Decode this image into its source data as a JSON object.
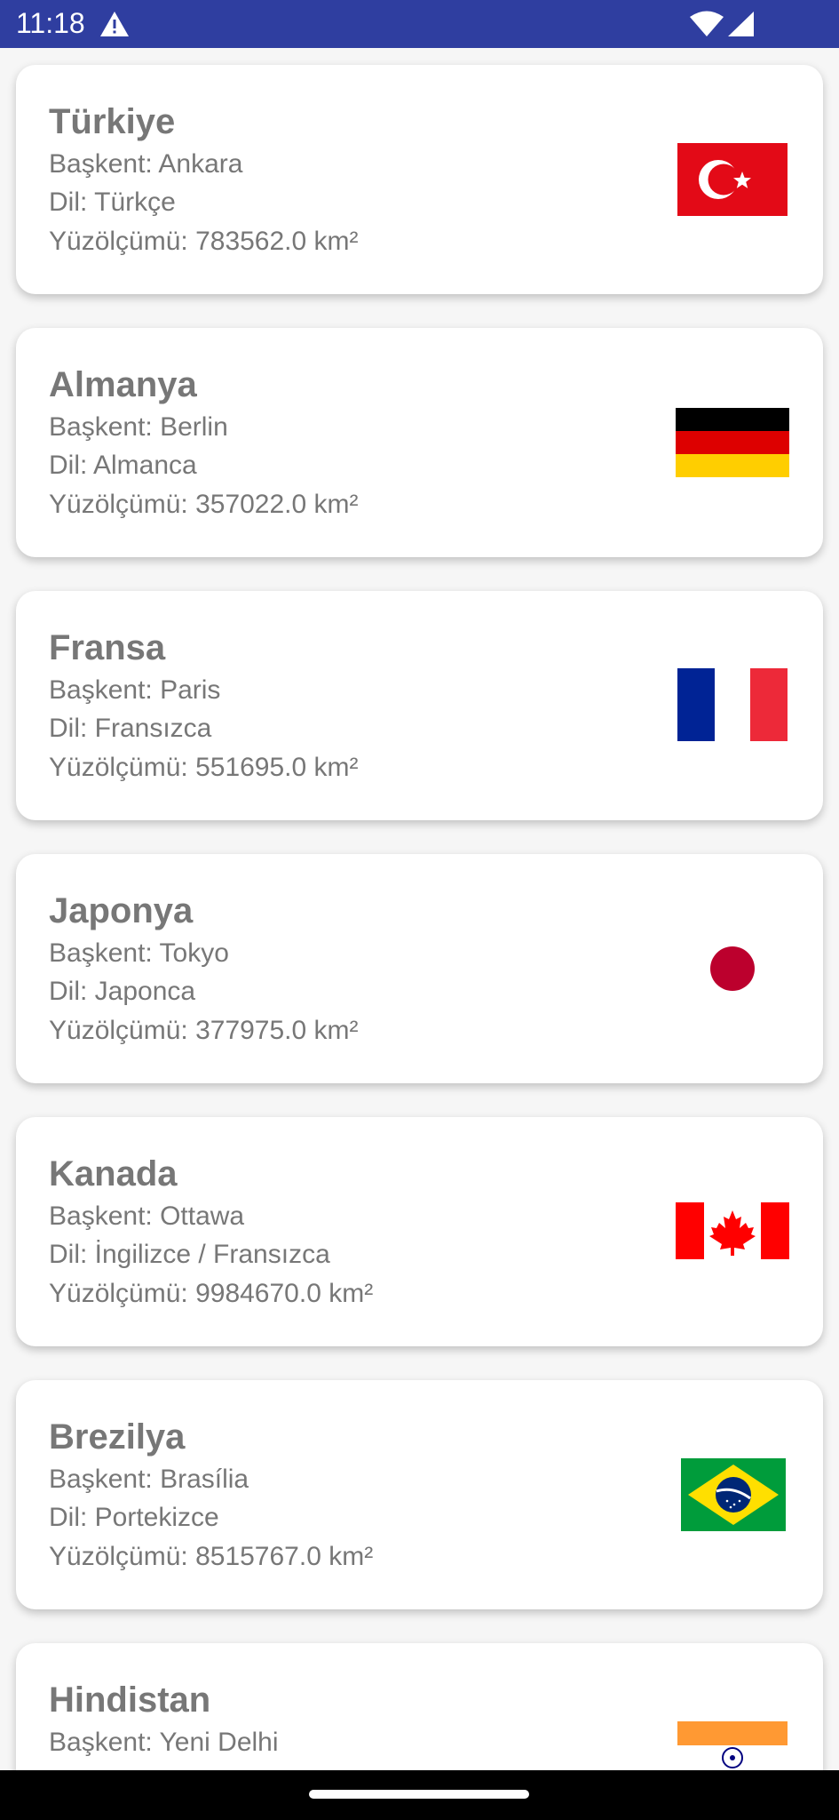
{
  "status_bar": {
    "time": "11:18",
    "icons": [
      "warning-icon",
      "wifi-icon",
      "signal-icon"
    ]
  },
  "countries": [
    {
      "name": "Türkiye",
      "capital": "Başkent: Ankara",
      "language": "Dil: Türkçe",
      "area": "Yüzölçümü: 783562.0 km²",
      "flag": "turkey-flag-icon"
    },
    {
      "name": "Almanya",
      "capital": "Başkent: Berlin",
      "language": "Dil: Almanca",
      "area": "Yüzölçümü: 357022.0 km²",
      "flag": "germany-flag-icon"
    },
    {
      "name": "Fransa",
      "capital": "Başkent: Paris",
      "language": "Dil: Fransızca",
      "area": "Yüzölçümü: 551695.0 km²",
      "flag": "france-flag-icon"
    },
    {
      "name": "Japonya",
      "capital": "Başkent: Tokyo",
      "language": "Dil: Japonca",
      "area": "Yüzölçümü: 377975.0 km²",
      "flag": "japan-flag-icon"
    },
    {
      "name": "Kanada",
      "capital": "Başkent: Ottawa",
      "language": "Dil: İngilizce / Fransızca",
      "area": "Yüzölçümü: 9984670.0 km²",
      "flag": "canada-flag-icon"
    },
    {
      "name": "Brezilya",
      "capital": "Başkent: Brasília",
      "language": "Dil: Portekizce",
      "area": "Yüzölçümü: 8515767.0 km²",
      "flag": "brazil-flag-icon"
    },
    {
      "name": "Hindistan",
      "capital": "Başkent: Yeni Delhi",
      "language": "",
      "area": "",
      "flag": "india-flag-icon"
    }
  ],
  "colors": {
    "status_bar": "#2f3ea0",
    "card_background": "#ffffff",
    "text": "#777777",
    "page_background": "#f6f6f6"
  }
}
